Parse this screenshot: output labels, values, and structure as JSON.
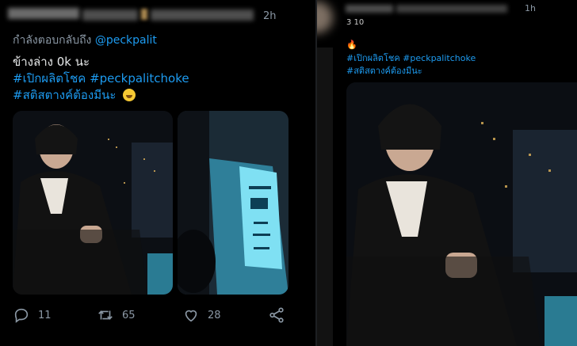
{
  "left_tweet": {
    "time": "2h",
    "reply_prefix": "กำลังตอบกลับถึง",
    "reply_mention": "@peckpalit",
    "line1": "ข้างล่าง 0k นะ",
    "tag1": "#เปิกผลิตโชค",
    "tag2": "#peckpalitchoke",
    "tag3": "#สติสตางค์ต้องมีนะ",
    "actions": {
      "reply_count": "11",
      "retweet_count": "65",
      "like_count": "28"
    }
  },
  "right_tweet": {
    "time": "1h",
    "subtext": "3 10",
    "tags_line1": "#เปิกผลิตโชค #peckpalitchoke",
    "tags_line2": "#สติสตางค์ต้องมีนะ"
  },
  "colors": {
    "background": "#000000",
    "link": "#1d9bf0",
    "muted": "#8b98a5",
    "text": "#e7e9ea"
  },
  "icons": [
    "reply-icon",
    "retweet-icon",
    "like-icon",
    "share-icon",
    "fire-icon",
    "grin-emoji"
  ]
}
